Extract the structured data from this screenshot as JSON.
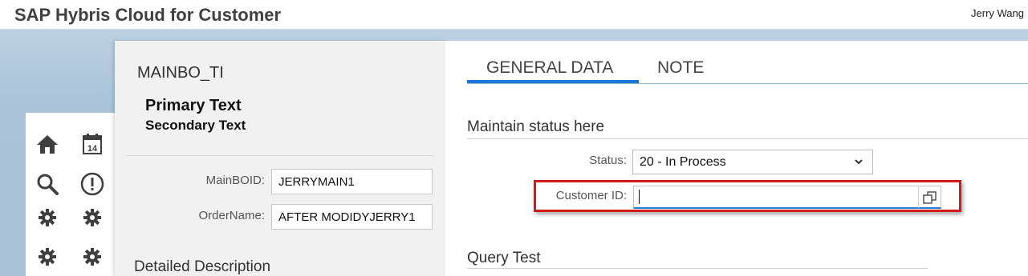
{
  "header": {
    "app_title": "SAP Hybris Cloud for Customer",
    "user_name": "Jerry Wang"
  },
  "launchpad": {
    "icons": [
      "home-icon",
      "calendar-icon",
      "search-icon",
      "alert-icon",
      "gear-icon",
      "gear-icon",
      "gear-icon",
      "gear-icon"
    ],
    "calendar_day": "14"
  },
  "left_panel": {
    "object_id": "MAINBO_TI",
    "primary_text": "Primary Text",
    "secondary_text": "Secondary Text",
    "fields": [
      {
        "label": "MainBOID:",
        "value": "JERRYMAIN1"
      },
      {
        "label": "OrderName:",
        "value": "AFTER MODIDYJERRY1"
      }
    ],
    "detail_title": "Detailed Description"
  },
  "tabs": [
    {
      "label": "GENERAL DATA",
      "selected": true
    },
    {
      "label": "NOTE",
      "selected": false
    }
  ],
  "general_data": {
    "section_title": "Maintain status here",
    "status_label": "Status:",
    "status_value": "20 - In Process",
    "customer_id_label": "Customer ID:",
    "customer_id_value": "",
    "query_section_title": "Query Test"
  },
  "colors": {
    "accent": "#1b77d4",
    "highlight": "#d11a1a",
    "shell_background": "#aac3d9"
  }
}
